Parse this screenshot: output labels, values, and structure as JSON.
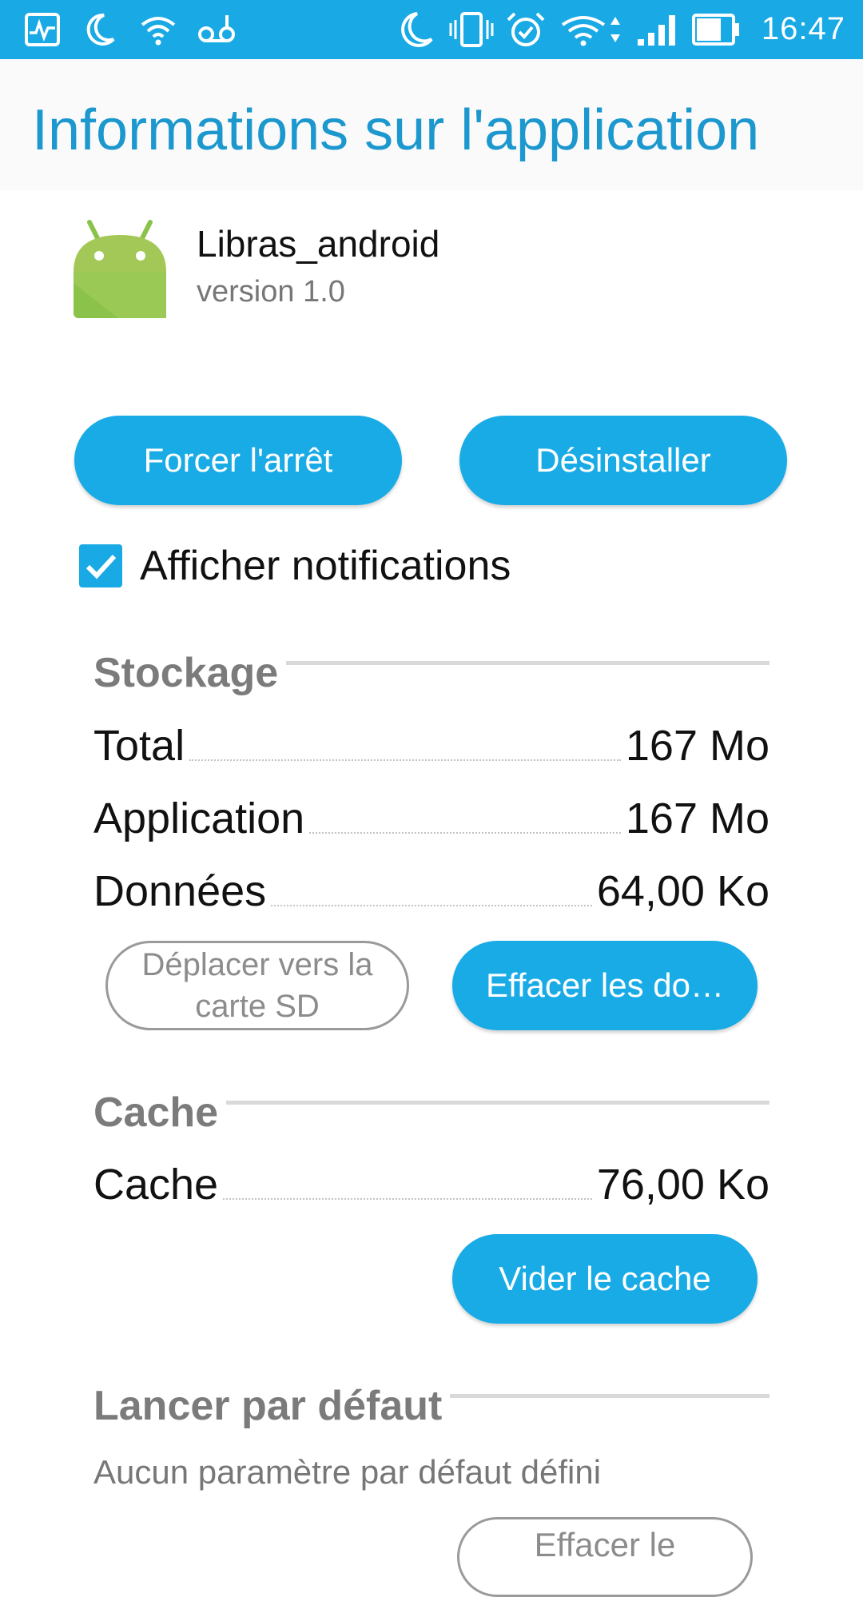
{
  "status_bar": {
    "time": "16:47",
    "icons": [
      "activity-icon",
      "moon-icon",
      "wifi-icon",
      "voicemail-icon",
      "moon-icon",
      "vibrate-icon",
      "alarm-icon",
      "wifi-data-icon",
      "signal-icon",
      "battery-icon"
    ],
    "color": "#19A9E4"
  },
  "header": {
    "title": "Informations sur l'application"
  },
  "app": {
    "name": "Libras_android",
    "version": "version 1.0"
  },
  "buttons": {
    "force_stop": "Forcer l'arrêt",
    "uninstall": "Désinstaller",
    "move_sd_line1": "Déplacer vers la",
    "move_sd_line2": "carte SD",
    "clear_data": "Effacer les do…",
    "clear_cache": "Vider le cache",
    "clear_defaults": "Effacer le"
  },
  "notifications": {
    "label": "Afficher notifications",
    "checked": true
  },
  "storage": {
    "title": "Stockage",
    "rows": [
      {
        "label": "Total",
        "value": "167 Mo"
      },
      {
        "label": "Application",
        "value": "167 Mo"
      },
      {
        "label": "Données",
        "value": "64,00 Ko"
      }
    ]
  },
  "cache": {
    "title": "Cache",
    "rows": [
      {
        "label": "Cache",
        "value": "76,00 Ko"
      }
    ]
  },
  "launch_default": {
    "title": "Lancer par défaut",
    "description": "Aucun paramètre par défaut défini"
  },
  "colors": {
    "accent": "#19ABE6",
    "title": "#1C98CE",
    "section": "#7b7b7b"
  }
}
